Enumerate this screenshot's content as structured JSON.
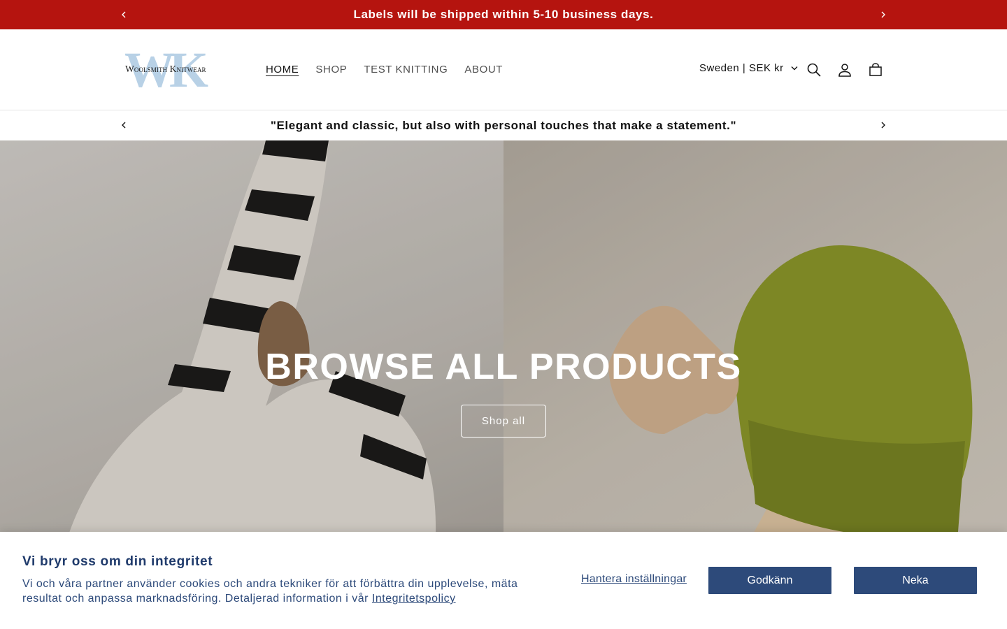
{
  "announcement": {
    "text": "Labels will be shipped within 5-10 business days."
  },
  "header": {
    "logo": {
      "monogram": "WK",
      "name": "Woolsmith Knitwear"
    },
    "nav": [
      {
        "label": "HOME",
        "active": true
      },
      {
        "label": "SHOP",
        "active": false
      },
      {
        "label": "TEST KNITTING",
        "active": false
      },
      {
        "label": "ABOUT",
        "active": false
      }
    ],
    "locale": "Sweden | SEK kr",
    "icons": [
      "search-icon",
      "account-icon",
      "cart-icon"
    ]
  },
  "quote": {
    "text": "\"Elegant and classic, but also with personal touches that make a statement.\""
  },
  "hero": {
    "title": "BROWSE ALL PRODUCTS",
    "button_label": "Shop all"
  },
  "cookie": {
    "title": "Vi bryr oss om din integritet",
    "body": "Vi och våra partner använder cookies och andra tekniker för att förbättra din upplevelse, mäta resultat och anpassa marknadsföring. Detaljerad information i vår ",
    "policy_link": "Integritetspolicy",
    "manage_label": "Hantera inställningar",
    "accept_label": "Godkänn",
    "decline_label": "Neka"
  },
  "colors": {
    "announcement_bg": "#b5140f",
    "cookie_accent": "#2d4a7a",
    "logo_monogram": "#b8d1e6"
  }
}
